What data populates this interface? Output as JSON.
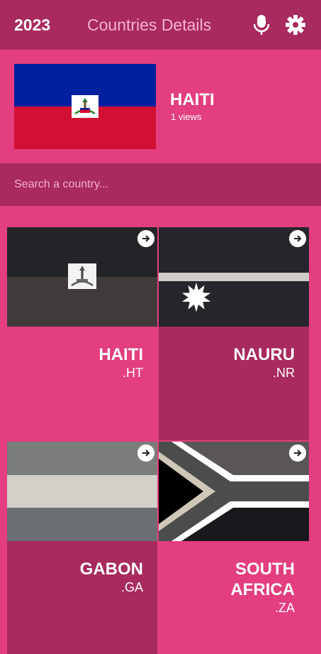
{
  "header": {
    "year": "2023",
    "title": "Countries Details",
    "mic_icon": "microphone-icon",
    "settings_icon": "gear-icon"
  },
  "featured": {
    "name": "HAITI",
    "views": "1 views",
    "flag_colors": [
      "#00209f",
      "#d21034",
      "#ffffff"
    ]
  },
  "search": {
    "placeholder": "Search a country..."
  },
  "countries": [
    {
      "name": "HAITI",
      "tld": ".HT"
    },
    {
      "name": "NAURU",
      "tld": ".NR"
    },
    {
      "name": "GABON",
      "tld": ".GA"
    },
    {
      "name": "SOUTH AFRICA",
      "name_lines": [
        "SOUTH",
        "AFRICA"
      ],
      "tld": ".ZA"
    }
  ],
  "colors": {
    "background": "#e33e7f",
    "bar": "#a82a5e",
    "card_alt": "#a82a5e"
  }
}
